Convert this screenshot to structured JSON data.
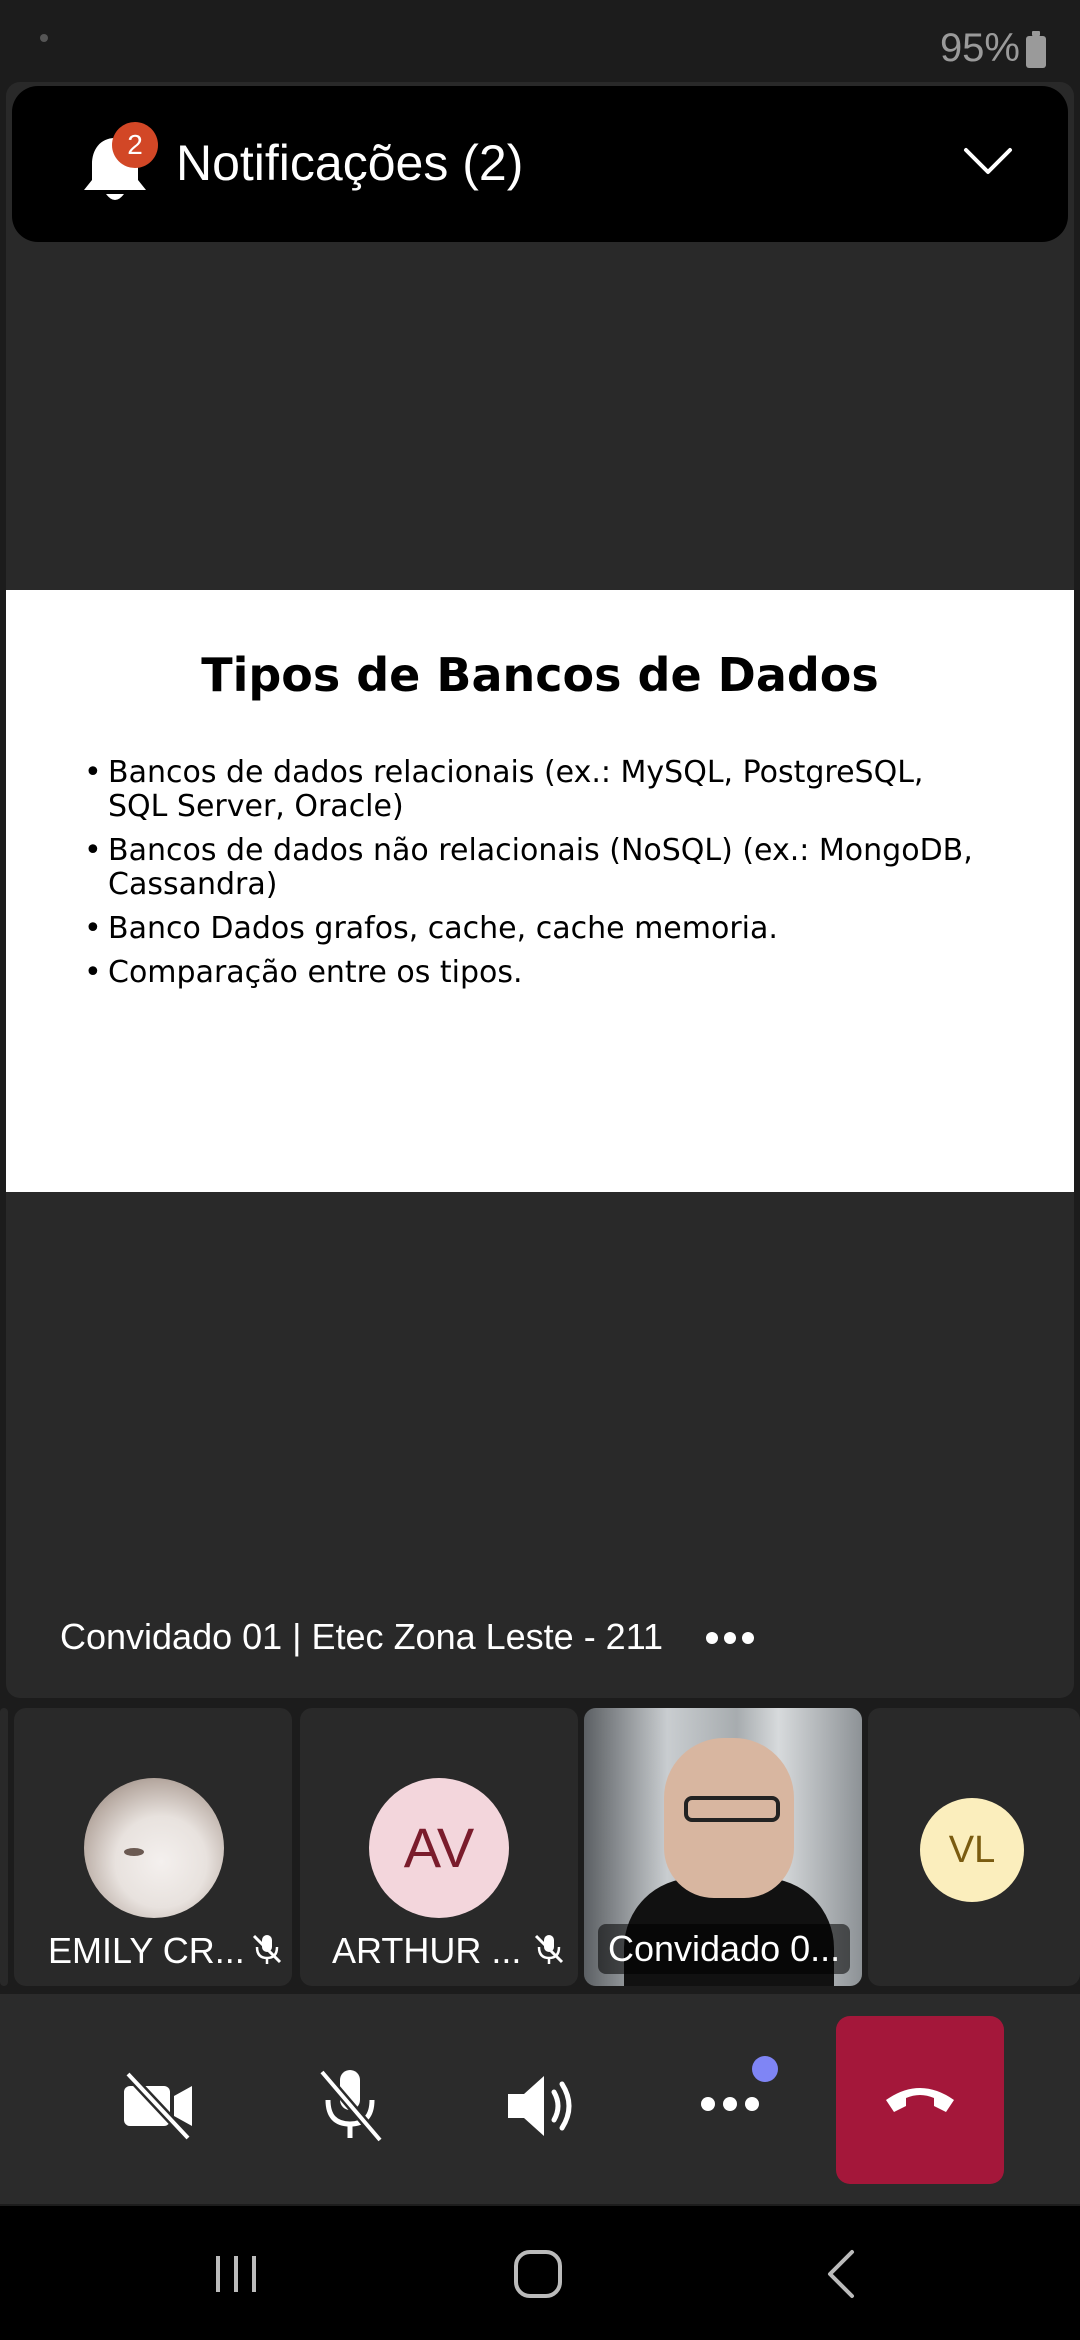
{
  "status_bar": {
    "battery": "95%"
  },
  "notifications": {
    "count": "2",
    "title": "Notificações (2)"
  },
  "slide": {
    "title": "Tipos de Bancos de Dados",
    "bullets": [
      "Bancos de dados relacionais (ex.: MySQL, PostgreSQL, SQL Server, Oracle)",
      "Bancos de dados não relacionais (NoSQL) (ex.: MongoDB, Cassandra)",
      "Banco Dados grafos, cache, cache memoria.",
      "Comparação entre os tipos."
    ]
  },
  "presenter": {
    "name": "Convidado 01 | Etec Zona Leste - 211"
  },
  "participants": [
    {
      "name": "EMILY CR...",
      "muted": true
    },
    {
      "name": "ARTHUR ...",
      "initials": "AV",
      "muted": true
    },
    {
      "name": "Convidado 0..."
    },
    {
      "initials": "VL"
    }
  ],
  "colors": {
    "hangup": "#a4173a",
    "badge": "#d24726",
    "more_dot": "#7f85f5"
  }
}
